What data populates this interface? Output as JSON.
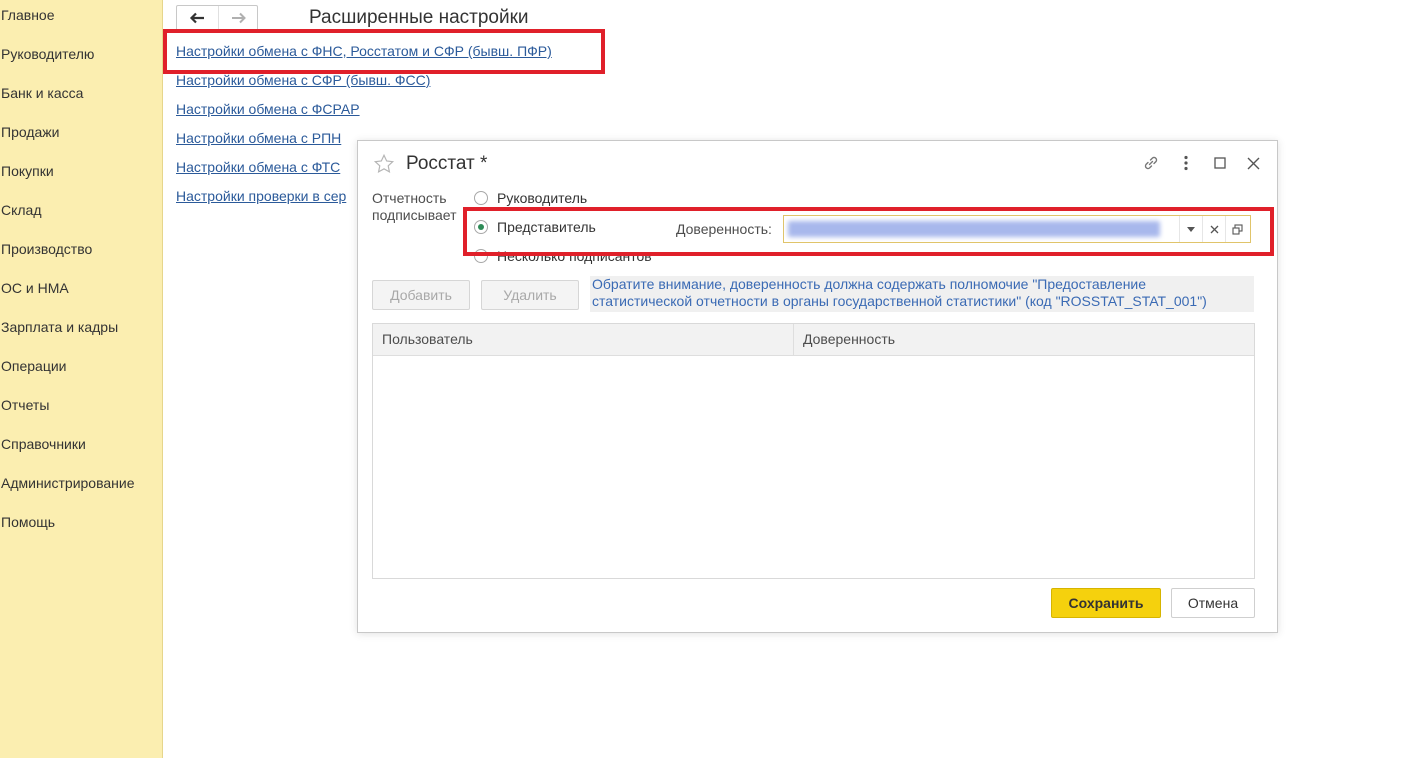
{
  "sidebar": {
    "items": [
      {
        "label": "Главное"
      },
      {
        "label": "Руководителю"
      },
      {
        "label": "Банк и касса"
      },
      {
        "label": "Продажи"
      },
      {
        "label": "Покупки"
      },
      {
        "label": "Склад"
      },
      {
        "label": "Производство"
      },
      {
        "label": "ОС и НМА"
      },
      {
        "label": "Зарплата и кадры"
      },
      {
        "label": "Операции"
      },
      {
        "label": "Отчеты"
      },
      {
        "label": "Справочники"
      },
      {
        "label": "Администрирование"
      },
      {
        "label": "Помощь"
      }
    ]
  },
  "header": {
    "back_icon": "arrow-left-icon",
    "forward_icon": "arrow-right-icon",
    "title": "Расширенные настройки"
  },
  "links": [
    {
      "label": "Настройки обмена с ФНС, Росстатом и СФР (бывш. ПФР)"
    },
    {
      "label": "Настройки обмена с СФР (бывш. ФСС)"
    },
    {
      "label": "Настройки обмена с ФСРАР"
    },
    {
      "label": "Настройки обмена с РПН"
    },
    {
      "label": "Настройки обмена с ФТС"
    },
    {
      "label": "Настройки проверки в сер"
    }
  ],
  "dialog": {
    "title": "Росстат *",
    "icons": {
      "favorite": "star-icon",
      "link": "link-icon",
      "more": "more-vertical-icon",
      "maximize": "maximize-icon",
      "close": "close-icon"
    },
    "reporting_label_line1": "Отчетность",
    "reporting_label_line2": "подписывает",
    "signer_options": [
      {
        "label": "Руководитель",
        "selected": false
      },
      {
        "label": "Представитель",
        "selected": true
      },
      {
        "label": "Несколько подписантов",
        "selected": false
      }
    ],
    "power_of_attorney_label": "Доверенность:",
    "power_of_attorney_value": "redacted",
    "field_icons": {
      "dropdown": "chevron-down-icon",
      "clear": "clear-icon",
      "open": "open-form-icon"
    },
    "add_button": "Добавить",
    "delete_button": "Удалить",
    "notice_line1": "Обратите внимание, доверенность должна содержать полномочие \"Предоставление",
    "notice_line2": "статистической отчетности в органы государственной статистики\" (код \"ROSSTAT_STAT_001\")",
    "table": {
      "columns": [
        "Пользователь",
        "Доверенность"
      ],
      "rows": []
    },
    "save_button": "Сохранить",
    "cancel_button": "Отмена"
  },
  "colors": {
    "sidebar_bg": "#fbeeb0",
    "link": "#2b5a9a",
    "primary_button": "#f5d10d",
    "highlight_frame": "#e0202a",
    "radio_selected": "#2e8b57"
  }
}
